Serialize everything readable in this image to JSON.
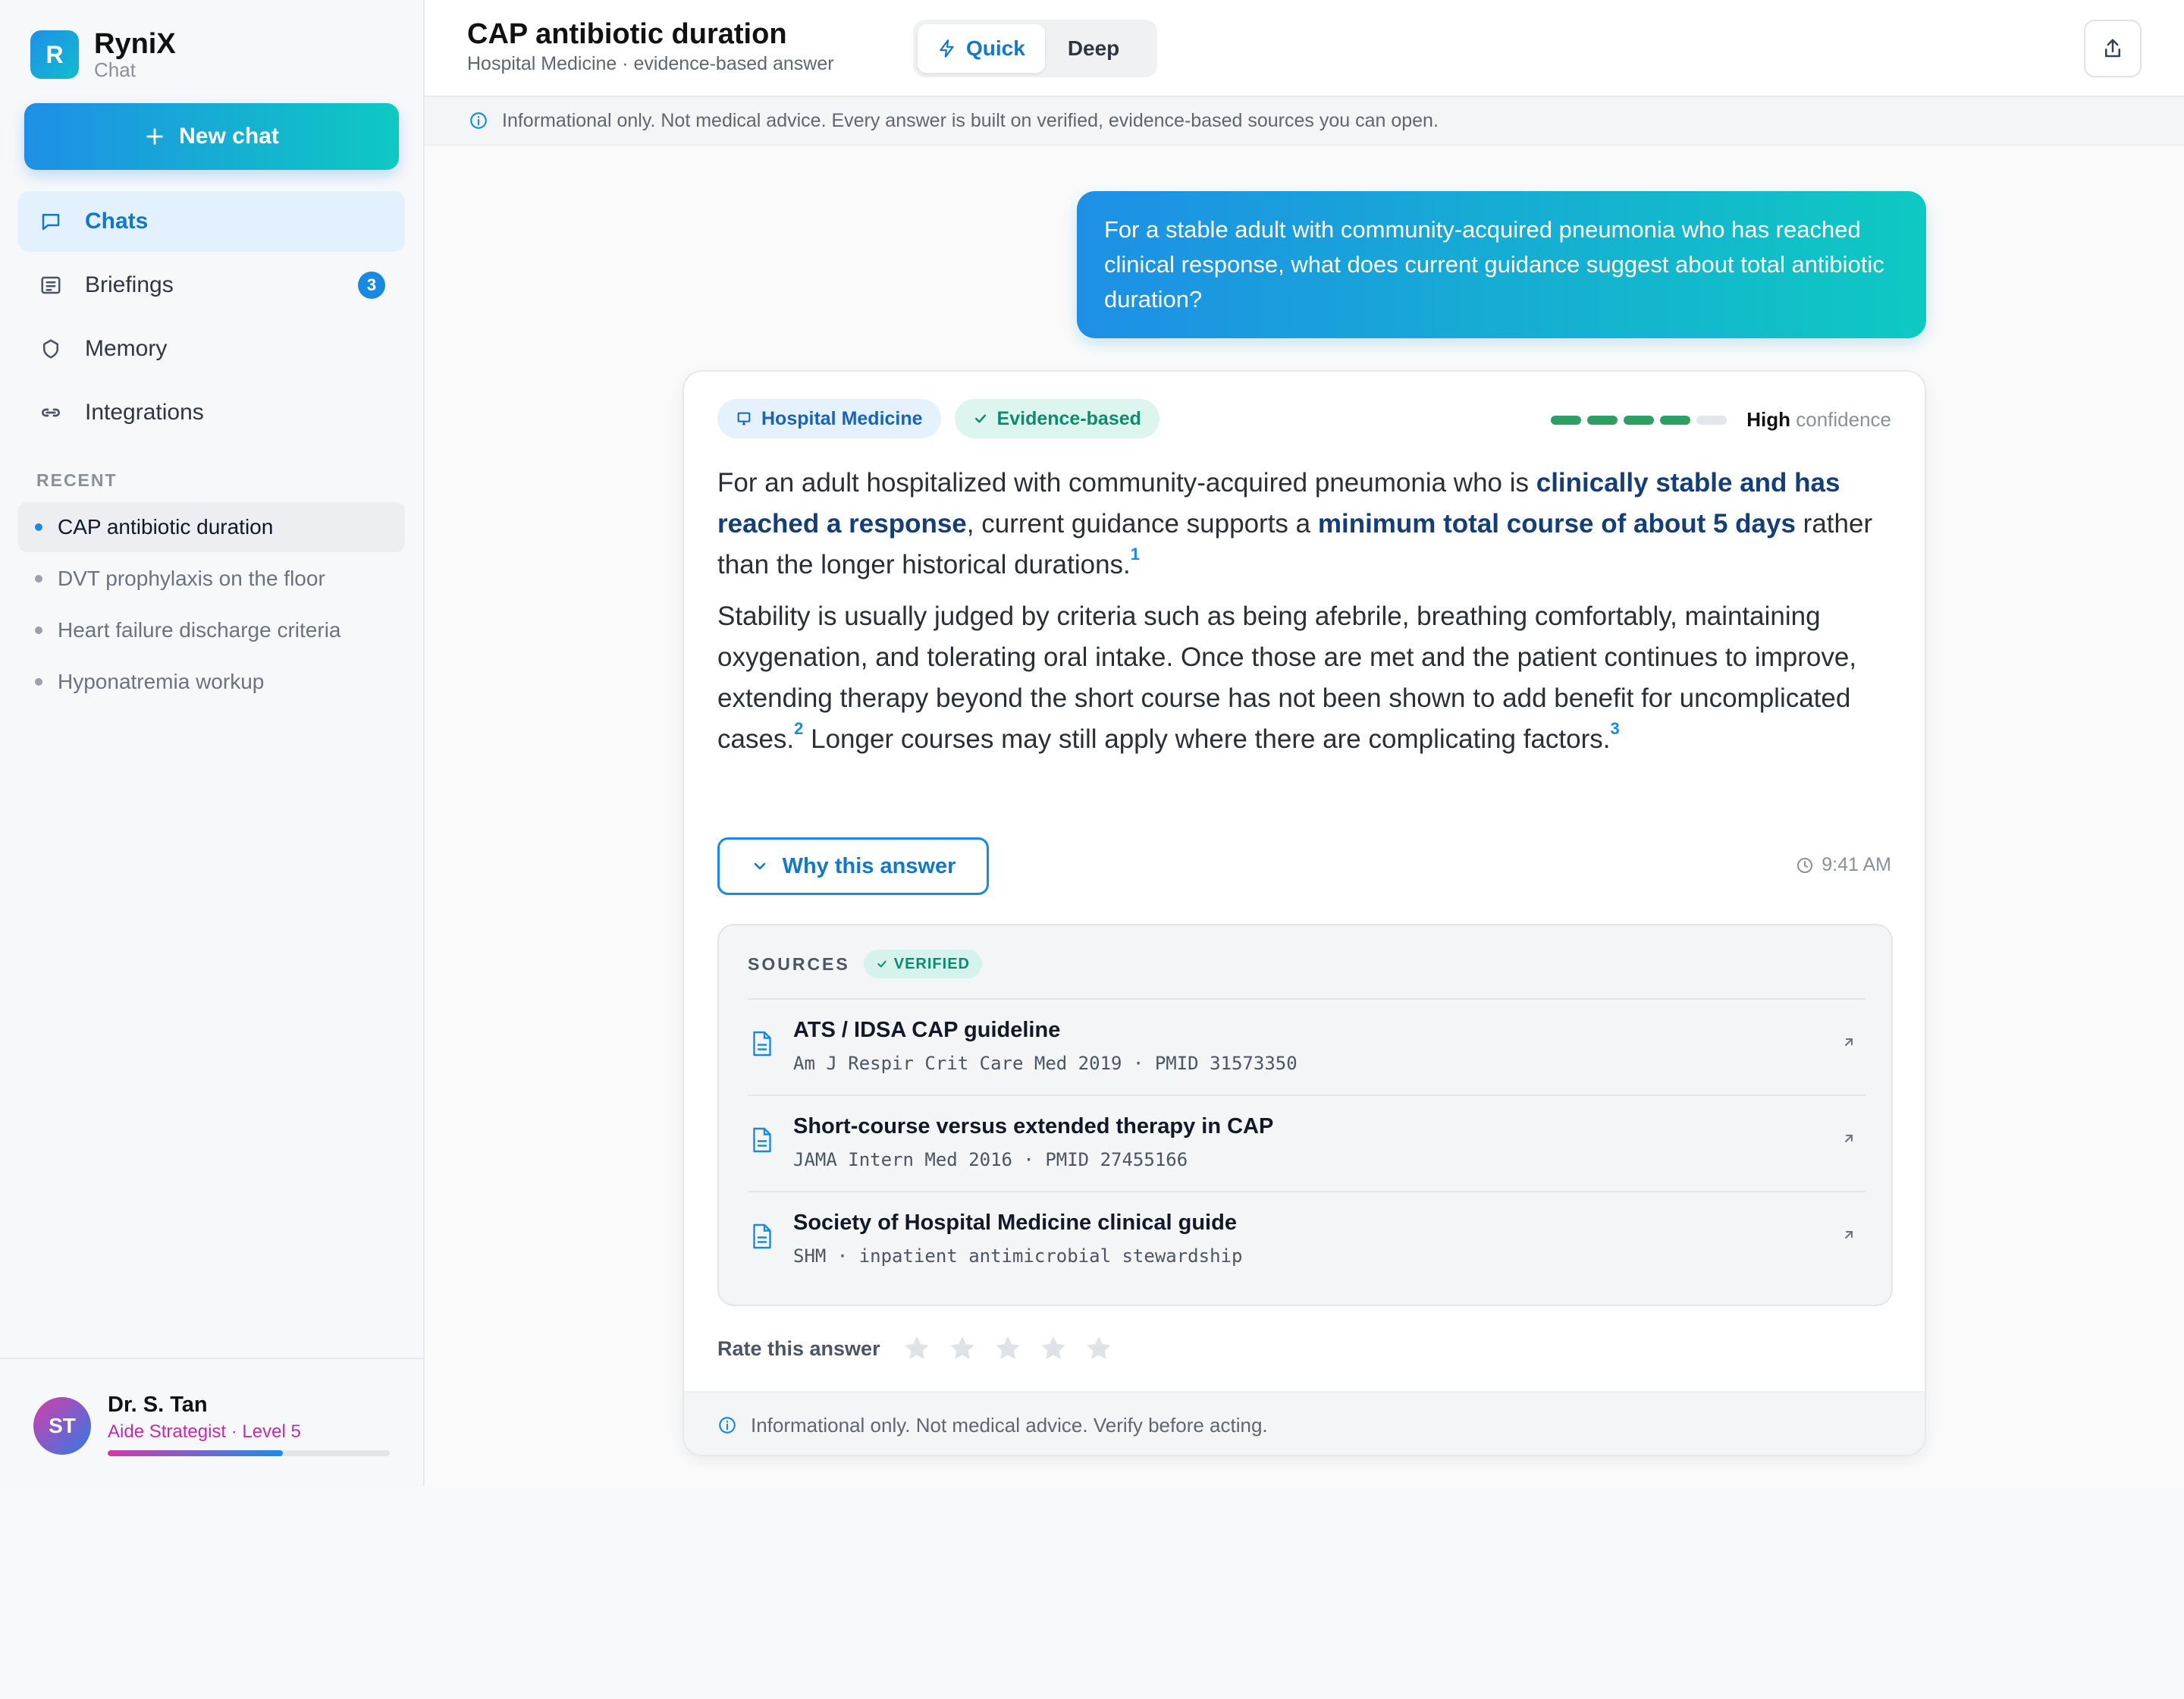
{
  "brand": {
    "name": "RyniX",
    "sub": "Chat",
    "logo_letter": "R"
  },
  "sidebar": {
    "new_chat": "New chat",
    "nav": [
      {
        "label": "Chats",
        "icon": "chat-bubble-icon",
        "active": true
      },
      {
        "label": "Briefings",
        "icon": "briefing-icon",
        "badge": "3"
      },
      {
        "label": "Memory",
        "icon": "memory-icon"
      },
      {
        "label": "Integrations",
        "icon": "link-icon"
      }
    ],
    "recent_title": "RECENT",
    "recent": [
      {
        "label": "CAP antibiotic duration",
        "active": true
      },
      {
        "label": "DVT prophylaxis on the floor"
      },
      {
        "label": "Heart failure discharge criteria"
      },
      {
        "label": "Hyponatremia workup"
      }
    ]
  },
  "profile": {
    "initials": "ST",
    "name": "Dr. S. Tan",
    "role": "Aide Strategist · Level 5",
    "progress": 0.62
  },
  "header": {
    "title": "CAP antibiotic duration",
    "subtitle": "Hospital Medicine · evidence-based answer",
    "mode_quick": "Quick",
    "mode_deep": "Deep",
    "active_mode": "Quick"
  },
  "info_banner": "Informational only. Not medical advice. Every answer is built on verified, evidence-based sources you can open.",
  "user_message": "For a stable adult with community-acquired pneumonia who has reached clinical response, what does current guidance suggest about total antibiotic duration?",
  "answer": {
    "tag_specialty": "Hospital Medicine",
    "tag_evidence": "Evidence-based",
    "confidence": {
      "level": 4,
      "max": 5,
      "label_strong": "High",
      "label": "confidence"
    },
    "p1": {
      "a": "For an adult hospitalized with community-acquired pneumonia who is ",
      "b": "clinically stable and has reached a response",
      "c": ", current guidance supports a ",
      "d": "minimum total course of about 5 days",
      "e": " rather than the longer historical durations.",
      "ref": "1"
    },
    "p2": {
      "a": "Stability is usually judged by criteria such as being afebrile, breathing comfortably, maintaining oxygenation, and tolerating oral intake. Once those are met and the patient continues to improve, extending therapy beyond the short course has not been shown to add benefit for uncomplicated cases.",
      "ref1": "2",
      "b": " Longer courses may still apply where there are complicating factors.",
      "ref2": "3"
    },
    "why_label": "Why this answer",
    "time": "9:41 AM",
    "sources_title": "SOURCES",
    "verified_label": "VERIFIED",
    "sources": [
      {
        "name": "ATS / IDSA CAP guideline",
        "meta": "Am J Respir Crit Care Med 2019 · PMID 31573350"
      },
      {
        "name": "Short-course versus extended therapy in CAP",
        "meta": "JAMA Intern Med 2016 · PMID 27455166"
      },
      {
        "name": "Society of Hospital Medicine clinical guide",
        "meta": "SHM · inpatient antimicrobial stewardship"
      }
    ],
    "rate_label": "Rate this answer",
    "rating": 0,
    "footer": "Informational only. Not medical advice. Verify before acting."
  },
  "colors": {
    "accent": "#1a8ae0",
    "accent_end": "#0ec9c2",
    "confidence": "#2f9e63",
    "emphasis": "#143e78"
  }
}
